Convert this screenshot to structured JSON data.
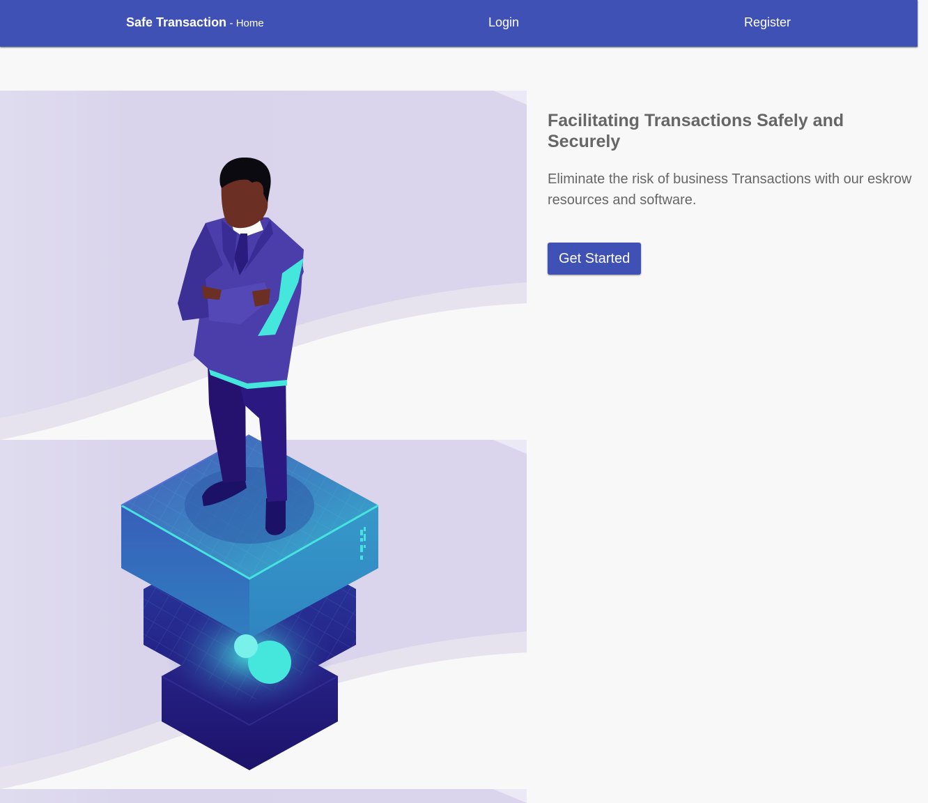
{
  "navbar": {
    "brand": "Safe Transaction",
    "separator": "- ",
    "page": "Home",
    "links": [
      "Login",
      "Register"
    ]
  },
  "hero": {
    "title": "Facilitating Transactions Safely and Securely",
    "description": "Eliminate the risk of business Transactions with our eskrow resources and software.",
    "cta_label": "Get Started"
  },
  "illustration": {
    "subject": "businessman standing on glowing server stack",
    "colors": {
      "background": "#dad5ec",
      "wave": "#e6e3ee",
      "suit": "#4b3eaa",
      "trousers": "#25126e",
      "server_top": "#3a8fc4",
      "server_dark": "#1f1675",
      "glow": "#45e6dc"
    }
  },
  "colors": {
    "primary": "#3f51b5",
    "text": "#666666",
    "page_bg": "#f8f8f8"
  }
}
